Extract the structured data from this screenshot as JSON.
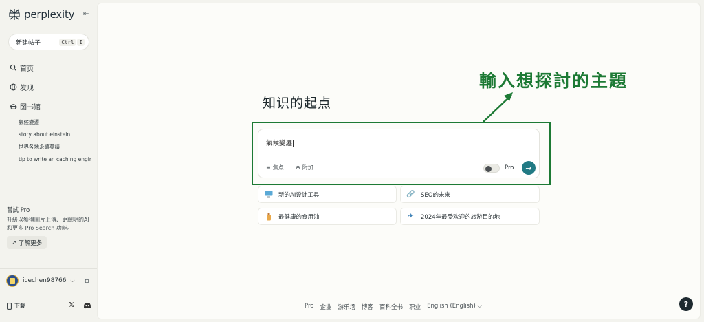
{
  "brand": {
    "name": "perplexity"
  },
  "sidebar": {
    "new_thread_label": "新建帖子",
    "shortcut": [
      "Ctrl",
      "I"
    ],
    "nav": [
      {
        "label": "首页",
        "icon": "search-icon"
      },
      {
        "label": "发现",
        "icon": "globe-icon"
      },
      {
        "label": "图书馆",
        "icon": "library-icon"
      }
    ],
    "library_items": [
      "氣候變遷",
      "story about einstein",
      "世界各地永續莫議",
      "tip to write an caching engine"
    ],
    "pro": {
      "title": "嘗試 Pro",
      "description": "升級以獲得圖片上傳、更聰明的AI和更多 Pro Search 功能。",
      "learn_more": "了解更多"
    },
    "user": {
      "name": "icechen98766"
    },
    "download_label": "下載"
  },
  "main": {
    "hero": "知识的起点",
    "annotation": "輸入想探討的主題",
    "search": {
      "value": "氣候變遷",
      "focus_label": "焦点",
      "attach_label": "附加",
      "pro_label": "Pro"
    },
    "suggestions": [
      {
        "label": "新的AI设计工具",
        "icon": "monitor-icon"
      },
      {
        "label": "SEO的未来",
        "icon": "link-icon"
      },
      {
        "label": "最健康的食用油",
        "icon": "bottle-icon"
      },
      {
        "label": "2024年最受欢迎的旅游目的地",
        "icon": "airplane-icon"
      }
    ],
    "footer": [
      "Pro",
      "企业",
      "游乐场",
      "博客",
      "百科全书",
      "职业",
      "English (English)"
    ]
  },
  "colors": {
    "accent": "#217a84",
    "annotation": "#1d7a35"
  }
}
